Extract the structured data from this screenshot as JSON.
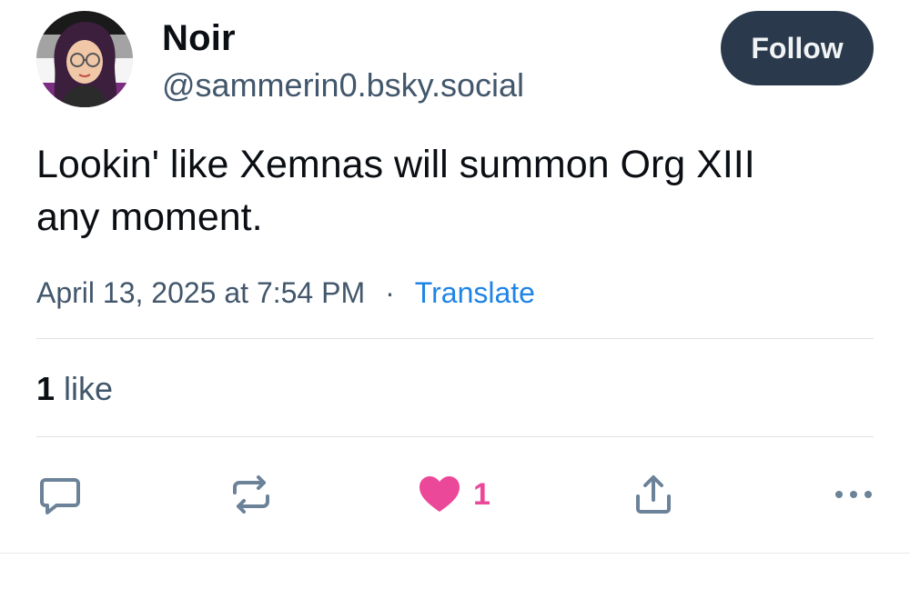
{
  "author": {
    "display_name": "Noir",
    "handle": "@sammerin0.bsky.social",
    "avatar_icon": "profile-avatar"
  },
  "follow_button": {
    "label": "Follow"
  },
  "post": {
    "text_line1": "Lookin' like Xemnas will summon Org XIII",
    "text_line2": "any moment.",
    "timestamp": "April 13, 2025 at 7:54 PM",
    "separator": "·",
    "translate_label": "Translate"
  },
  "stats": {
    "likes_number": "1",
    "likes_label": "like"
  },
  "actions": {
    "reply_icon": "reply-icon",
    "repost_icon": "repost-icon",
    "like_icon": "heart-icon",
    "like_count": "1",
    "share_icon": "share-icon",
    "more_icon": "more-icon"
  },
  "colors": {
    "handle": "#42576c",
    "follow_bg": "#2a3a4c",
    "link": "#1f84e6",
    "like": "#ec4899"
  }
}
